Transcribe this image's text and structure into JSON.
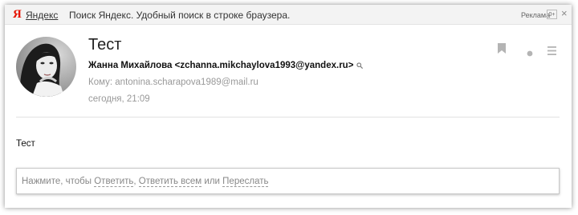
{
  "ad_bar": {
    "logo": "Я",
    "brand": "Яндекс",
    "text": "Поиск Яндекс. Удобный поиск в строке браузера.",
    "label": "Реклама",
    "age": "0+",
    "close": "×"
  },
  "message": {
    "subject": "Тест",
    "from": "Жанна Михайлова <zchanna.mikchaylova1993@yandex.ru>",
    "to_label": "Кому:",
    "to": "antonina.scharapova1989@mail.ru",
    "date": "сегодня, 21:09",
    "body": "Тест"
  },
  "reply": {
    "prefix": "Нажмите, чтобы",
    "reply": "Ответить",
    "sep1": ",",
    "reply_all": "Ответить всем",
    "or": "или",
    "forward": "Переслать"
  },
  "icons": [
    "bookmark-icon",
    "dot-icon",
    "menu-icon",
    "search-icon"
  ],
  "colors": {
    "logo_red": "#e61400",
    "muted_text": "#999999",
    "icon_gray": "#b4b4b4"
  }
}
